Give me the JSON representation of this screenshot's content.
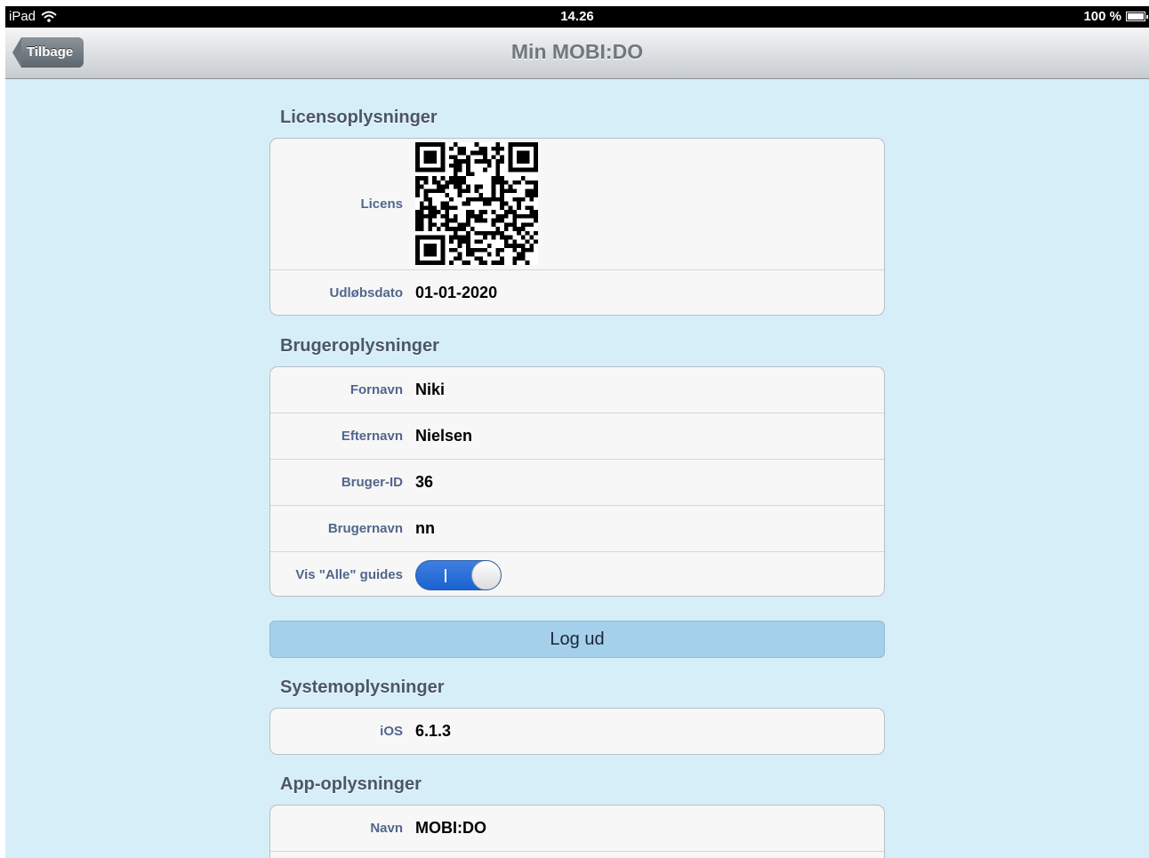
{
  "status_bar": {
    "carrier": "iPad",
    "time": "14.26",
    "battery": "100 %"
  },
  "nav": {
    "back_label": "Tilbage",
    "title": "Min MOBI:DO"
  },
  "license": {
    "header": "Licensoplysninger",
    "rows": [
      {
        "label": "Licens"
      },
      {
        "label": "Udløbsdato",
        "value": "01-01-2020"
      }
    ]
  },
  "user": {
    "header": "Brugeroplysninger",
    "rows": [
      {
        "label": "Fornavn",
        "value": "Niki"
      },
      {
        "label": "Efternavn",
        "value": "Nielsen"
      },
      {
        "label": "Bruger-ID",
        "value": "36"
      },
      {
        "label": "Brugernavn",
        "value": "nn"
      },
      {
        "label": "Vis \"Alle\" guides",
        "toggle_on": true
      }
    ]
  },
  "logout_label": "Log ud",
  "system": {
    "header": "Systemoplysninger",
    "rows": [
      {
        "label": "iOS",
        "value": "6.1.3"
      }
    ]
  },
  "app": {
    "header": "App-oplysninger",
    "rows": [
      {
        "label": "Navn",
        "value": "MOBI:DO"
      }
    ]
  },
  "icons": {
    "wifi": "wifi-icon",
    "battery": "battery-icon",
    "back": "back-arrow-icon",
    "qr": "qr-code-icon"
  }
}
